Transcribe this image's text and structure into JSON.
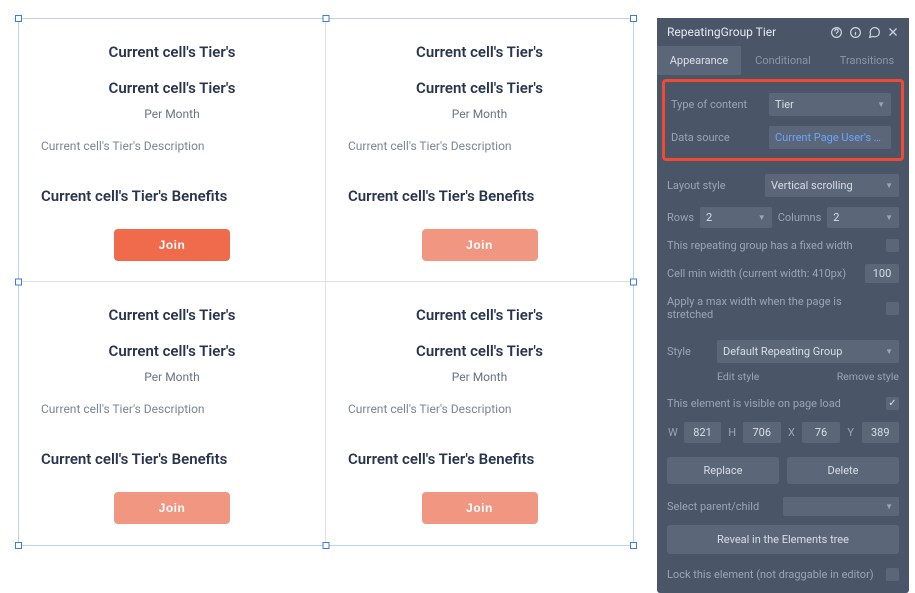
{
  "cell": {
    "title1": "Current cell's Tier's",
    "title2": "Current cell's Tier's",
    "per": "Per Month",
    "desc": "Current cell's Tier's Description",
    "benefits": "Current cell's Tier's Benefits",
    "join": "Join"
  },
  "panel": {
    "title": "RepeatingGroup Tier",
    "tabs": {
      "appearance": "Appearance",
      "conditional": "Conditional",
      "transitions": "Transitions"
    },
    "type_of_content_label": "Type of content",
    "type_of_content_value": "Tier",
    "data_source_label": "Data source",
    "data_source_value": "Current Page User's Tiers",
    "layout_style_label": "Layout style",
    "layout_style_value": "Vertical scrolling",
    "rows_label": "Rows",
    "rows_value": "2",
    "columns_label": "Columns",
    "columns_value": "2",
    "fixed_width_label": "This repeating group has a fixed width",
    "cell_min_width_label": "Cell min width (current width: 410px)",
    "cell_min_width_value": "100",
    "max_width_label": "Apply a max width when the page is stretched",
    "style_label": "Style",
    "style_value": "Default Repeating Group",
    "edit_style": "Edit style",
    "remove_style": "Remove style",
    "visible_label": "This element is visible on page load",
    "w_label": "W",
    "w_value": "821",
    "h_label": "H",
    "h_value": "706",
    "x_label": "X",
    "x_value": "76",
    "y_label": "Y",
    "y_value": "389",
    "replace": "Replace",
    "delete": "Delete",
    "select_parent_label": "Select parent/child",
    "reveal": "Reveal in the Elements tree",
    "lock_label": "Lock this element (not draggable in editor)"
  }
}
